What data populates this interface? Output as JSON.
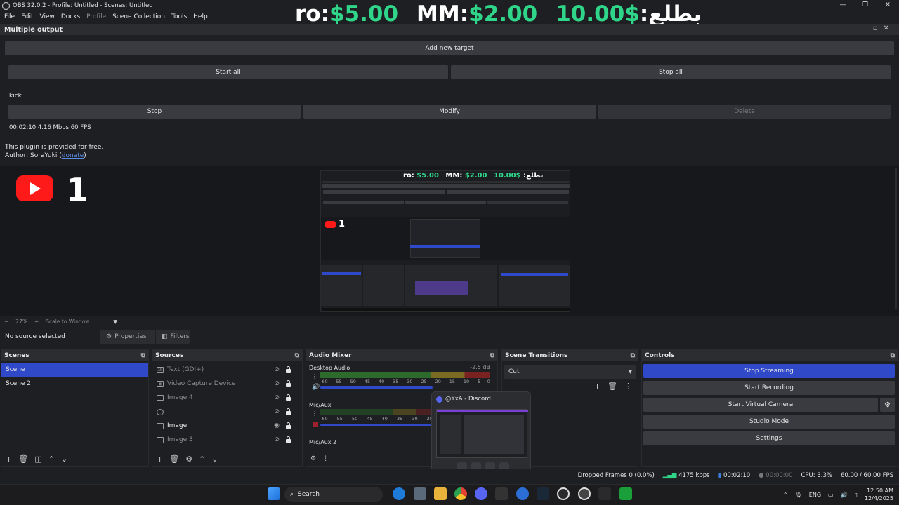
{
  "titlebar": {
    "title": "OBS 32.0.2 - Profile: Untitled - Scenes: Untitled",
    "minimize": "—",
    "restore": "❐",
    "close": "✕"
  },
  "menu": {
    "items": [
      "File",
      "Edit",
      "View",
      "Docks",
      "Profile",
      "Scene Collection",
      "Tools",
      "Help"
    ]
  },
  "ticker": {
    "part1_white": "ro: ",
    "part1_green": "$5.00",
    "part2_white": "MM: ",
    "part2_green": "$2.00",
    "part3_green": "10.00$",
    "part3_white": " :بطلع"
  },
  "multiple_output": {
    "title": "Multiple output",
    "add_target": "Add new target",
    "start_all": "Start all",
    "stop_all": "Stop all",
    "target_name": "kick",
    "stop": "Stop",
    "modify": "Modify",
    "delete": "Delete",
    "stats": "00:02:10  4.16 Mbps  60 FPS",
    "plugin_note": "This plugin is provided for free.",
    "author_prefix": "Author: SoraYuki (",
    "donate": "donate",
    "author_suffix": ")"
  },
  "preview": {
    "overlay_count": "1",
    "mini_overlay_count": "1",
    "mini_ticker_1w": "ro: ",
    "mini_ticker_1g": "$5.00",
    "mini_ticker_2w": "MM: ",
    "mini_ticker_2g": "$2.00",
    "mini_ticker_3g": "10.00$",
    "mini_ticker_3w": " :بطلع"
  },
  "zoom": {
    "minus": "−",
    "level": "27%",
    "plus": "+",
    "mode": "Scale to Window"
  },
  "source_toolbar": {
    "no_source": "No source selected",
    "properties": "Properties",
    "filters": "Filters"
  },
  "scenes": {
    "title": "Scenes",
    "items": [
      "Scene",
      "Scene 2"
    ]
  },
  "sources": {
    "title": "Sources",
    "items": [
      {
        "label": "Text (GDI+)",
        "icon": "ab"
      },
      {
        "label": "Video Capture Device",
        "icon": "camera"
      },
      {
        "label": "Image 4",
        "icon": "image"
      },
      {
        "label": "",
        "icon": "browser"
      },
      {
        "label": "Image",
        "icon": "image"
      },
      {
        "label": "Image 3",
        "icon": "image"
      }
    ]
  },
  "audio_mixer": {
    "title": "Audio Mixer",
    "channels": [
      {
        "name": "Desktop Audio",
        "db": "-2.5 dB"
      },
      {
        "name": "Mic/Aux",
        "db": ""
      },
      {
        "name": "Mic/Aux 2",
        "db": ""
      }
    ],
    "scale": [
      "-60",
      "-55",
      "-50",
      "-45",
      "-40",
      "-35",
      "-30",
      "-25",
      "-20",
      "-15",
      "-10",
      "-5",
      "0"
    ]
  },
  "transitions": {
    "title": "Scene Transitions",
    "selected": "Cut"
  },
  "controls": {
    "title": "Controls",
    "stop_streaming": "Stop Streaming",
    "start_recording": "Start Recording",
    "start_virtual_camera": "Start Virtual Camera",
    "studio_mode": "Studio Mode",
    "settings": "Settings"
  },
  "discord": {
    "title": "@YxA - Discord"
  },
  "status": {
    "dropped_frames": "Dropped Frames 0 (0.0%)",
    "bitrate": "4175 kbps",
    "stream_time": "00:02:10",
    "rec_time": "00:00:00",
    "cpu": "CPU: 3.3%",
    "fps": "60.00 / 60.00 FPS"
  },
  "taskbar": {
    "search": "Search",
    "lang": "ENG",
    "time": "12:50 AM",
    "date": "12/4/2025"
  },
  "colors": {
    "accent_blue": "#2f49c9",
    "ticker_green": "#2fd68a",
    "youtube_red": "#ff1a1a"
  }
}
